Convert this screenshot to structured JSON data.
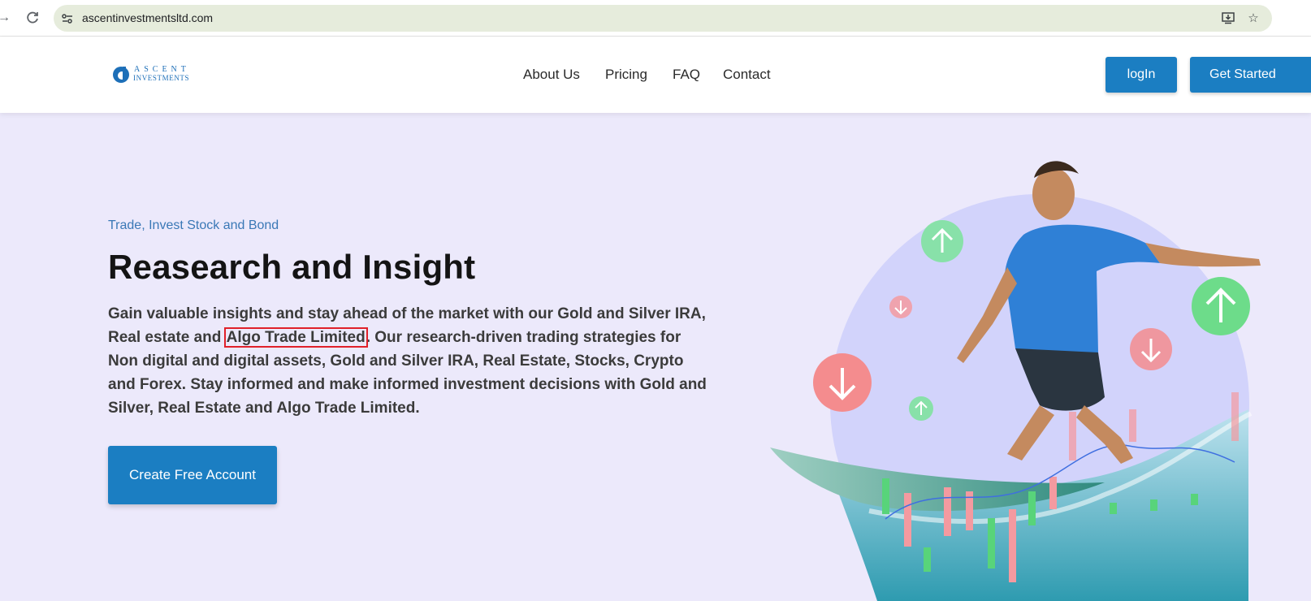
{
  "browser": {
    "url": "ascentinvestmentsltd.com",
    "icons": [
      "forward-arrow-icon",
      "reload-icon",
      "site-info-icon",
      "install-app-icon",
      "bookmark-star-icon"
    ]
  },
  "header": {
    "logo": {
      "word1": "ASCENT",
      "word2": "INVESTMENTS"
    },
    "nav": [
      "About Us",
      "Pricing",
      "FAQ",
      "Contact"
    ],
    "login_label": "logIn",
    "get_started_label": "Get Started"
  },
  "hero": {
    "eyebrow": "Trade, Invest Stock and Bond",
    "headline": "Reasearch and Insight",
    "desc_part1": "Gain valuable insights and stay ahead of the market with our Gold and Silver IRA, Real estate and ",
    "desc_highlight": "Algo Trade Limited",
    "desc_part2": ". Our research-driven trading strategies for Non digital and digital assets, Gold and Silver IRA, Real Estate, Stocks, Crypto and Forex. Stay informed and make informed investment decisions with Gold and Silver, Real Estate and Algo Trade Limited.",
    "cta_label": "Create Free Account"
  },
  "colors": {
    "accent": "#1b7ec2",
    "hero_bg": "#ece9fb",
    "highlight_border": "#e0202a",
    "up_green": "#6fdc8c",
    "down_red": "#f4898b"
  }
}
